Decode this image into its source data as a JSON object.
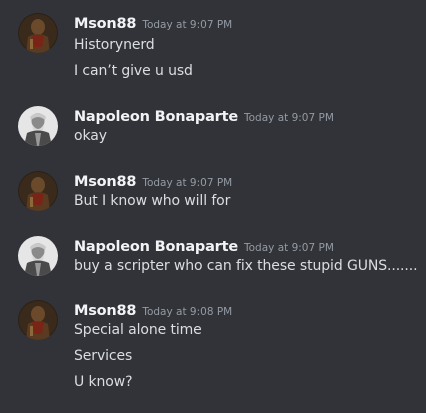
{
  "messages": [
    {
      "author": "Mson88",
      "timestamp": "Today at 9:07 PM",
      "avatar": "mson88-avatar",
      "lines": [
        "Historynerd",
        "I can’t give u usd"
      ]
    },
    {
      "author": "Napoleon Bonaparte",
      "timestamp": "Today at 9:07 PM",
      "avatar": "napoleon-avatar",
      "lines": [
        "okay"
      ]
    },
    {
      "author": "Mson88",
      "timestamp": "Today at 9:07 PM",
      "avatar": "mson88-avatar",
      "lines": [
        "But I know who will for"
      ]
    },
    {
      "author": "Napoleon Bonaparte",
      "timestamp": "Today at 9:07 PM",
      "avatar": "napoleon-avatar",
      "lines": [
        "buy a scripter who can fix these stupid GUNS......."
      ]
    },
    {
      "author": "Mson88",
      "timestamp": "Today at 9:08 PM",
      "avatar": "mson88-avatar",
      "lines": [
        "Special alone time",
        "Services",
        "U know?"
      ]
    }
  ],
  "colors": {
    "background": "#313338",
    "author": "#f2f3f5",
    "timestamp": "#949ba4",
    "text": "#dbdee1"
  }
}
